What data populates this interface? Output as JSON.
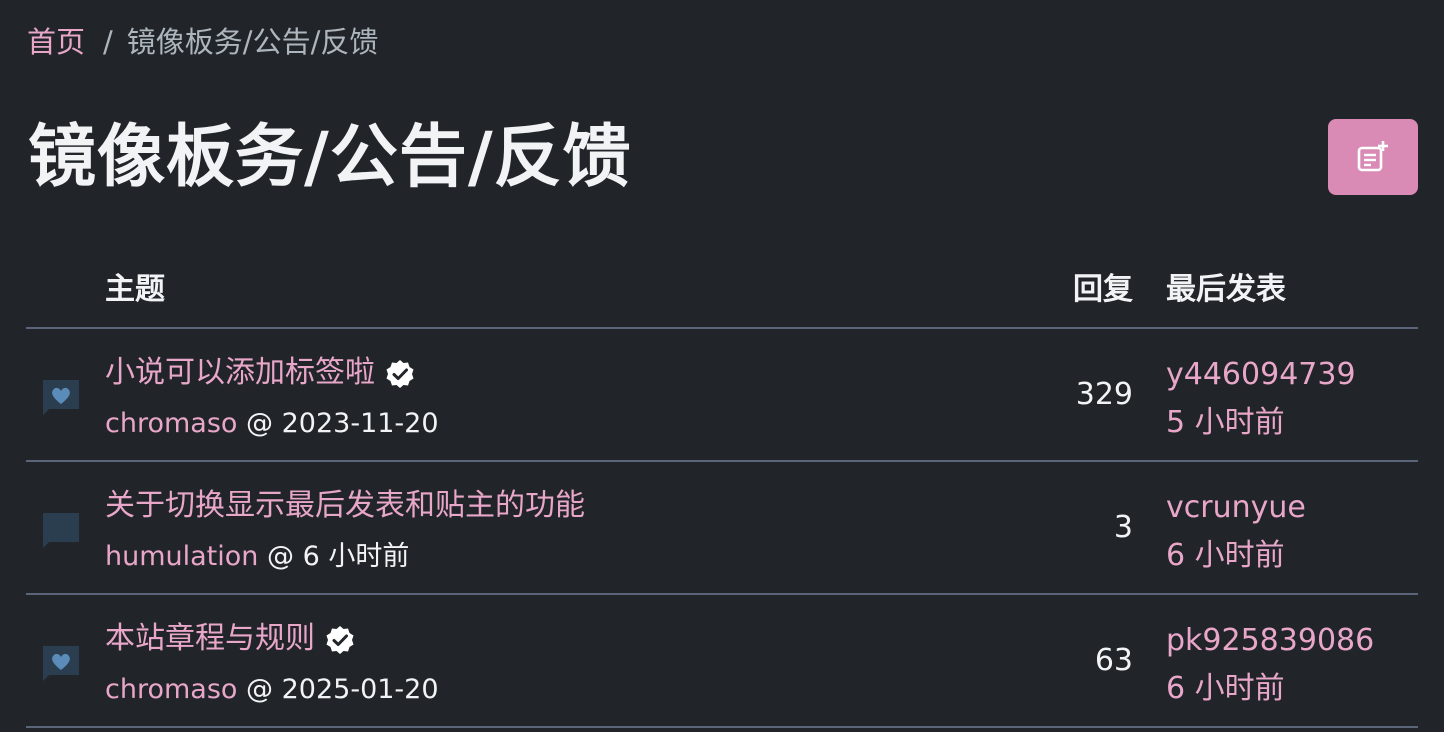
{
  "breadcrumb": {
    "home": "首页",
    "separator": "/",
    "current": "镜像板务/公告/反馈"
  },
  "page": {
    "title": "镜像板务/公告/反馈",
    "new_topic_icon": "note-add-icon"
  },
  "table": {
    "headers": {
      "topic": "主题",
      "replies": "回复",
      "last_post": "最后发表"
    },
    "rows": [
      {
        "title": "小说可以添加标签啦",
        "verified": true,
        "icon": "heart-chat-icon",
        "author": "chromaso",
        "at": "@",
        "date": "2023-11-20",
        "replies": "329",
        "last_user": "y446094739",
        "last_time": "5 小时前"
      },
      {
        "title": "关于切换显示最后发表和贴主的功能",
        "verified": false,
        "icon": "chat-icon",
        "author": "humulation",
        "at": "@",
        "date": "6 小时前",
        "replies": "3",
        "last_user": "vcrunyue",
        "last_time": "6 小时前"
      },
      {
        "title": "本站章程与规则",
        "verified": true,
        "icon": "heart-chat-icon",
        "author": "chromaso",
        "at": "@",
        "date": "2025-01-20",
        "replies": "63",
        "last_user": "pk925839086",
        "last_time": "6 小时前"
      }
    ]
  },
  "colors": {
    "background": "#212529",
    "link": "#e8a6c9",
    "button": "#d98bb5",
    "icon_bg": "#2b3e50",
    "heart": "#5b8bb8",
    "divider": "#5c6479"
  }
}
